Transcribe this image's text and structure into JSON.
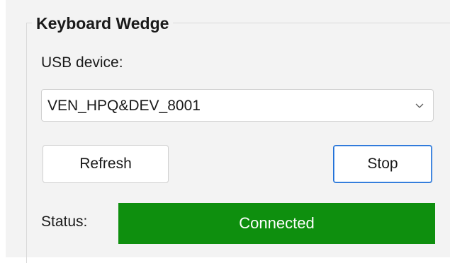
{
  "group": {
    "title": "Keyboard Wedge"
  },
  "usb": {
    "label": "USB device:",
    "selected_device": "VEN_HPQ&DEV_8001"
  },
  "buttons": {
    "refresh_label": "Refresh",
    "stop_label": "Stop"
  },
  "status": {
    "label": "Status:",
    "value": "Connected",
    "color": "#0e8f0e"
  },
  "icons": {
    "dropdown": "chevron-down-icon"
  }
}
